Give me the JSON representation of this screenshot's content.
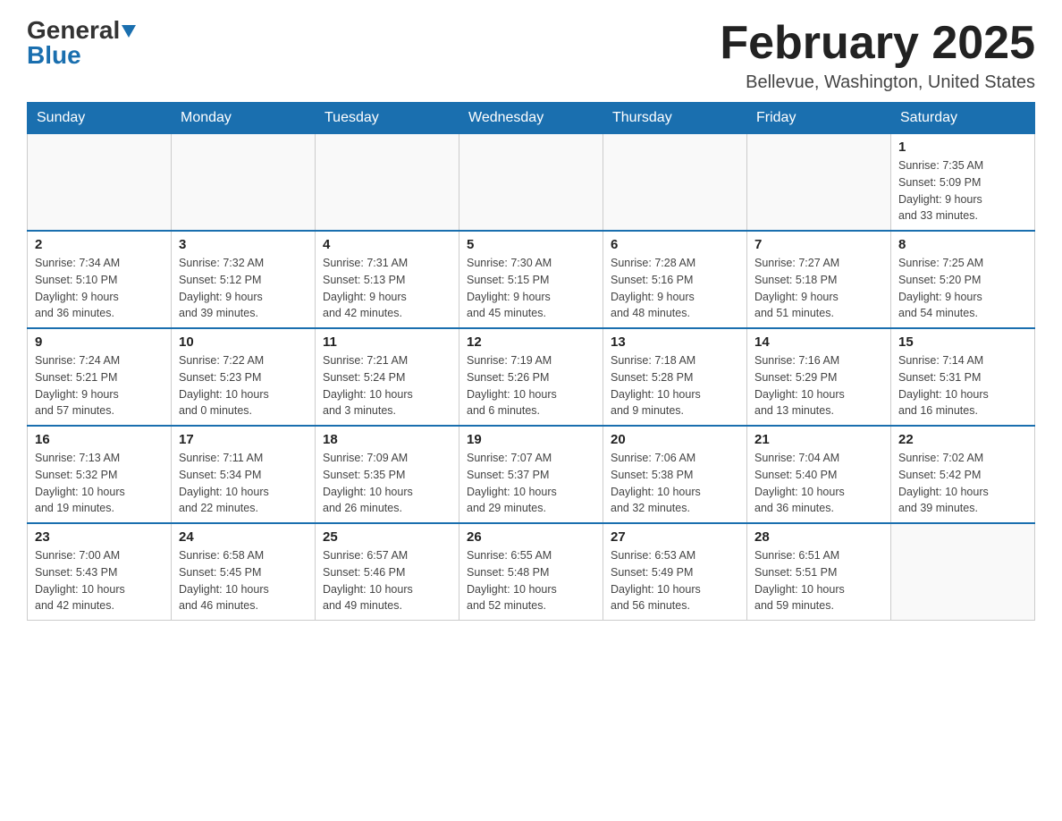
{
  "header": {
    "logo_general": "General",
    "logo_blue": "Blue",
    "month_title": "February 2025",
    "location": "Bellevue, Washington, United States"
  },
  "days_of_week": [
    "Sunday",
    "Monday",
    "Tuesday",
    "Wednesday",
    "Thursday",
    "Friday",
    "Saturday"
  ],
  "weeks": [
    {
      "days": [
        {
          "number": "",
          "info": ""
        },
        {
          "number": "",
          "info": ""
        },
        {
          "number": "",
          "info": ""
        },
        {
          "number": "",
          "info": ""
        },
        {
          "number": "",
          "info": ""
        },
        {
          "number": "",
          "info": ""
        },
        {
          "number": "1",
          "info": "Sunrise: 7:35 AM\nSunset: 5:09 PM\nDaylight: 9 hours\nand 33 minutes."
        }
      ]
    },
    {
      "days": [
        {
          "number": "2",
          "info": "Sunrise: 7:34 AM\nSunset: 5:10 PM\nDaylight: 9 hours\nand 36 minutes."
        },
        {
          "number": "3",
          "info": "Sunrise: 7:32 AM\nSunset: 5:12 PM\nDaylight: 9 hours\nand 39 minutes."
        },
        {
          "number": "4",
          "info": "Sunrise: 7:31 AM\nSunset: 5:13 PM\nDaylight: 9 hours\nand 42 minutes."
        },
        {
          "number": "5",
          "info": "Sunrise: 7:30 AM\nSunset: 5:15 PM\nDaylight: 9 hours\nand 45 minutes."
        },
        {
          "number": "6",
          "info": "Sunrise: 7:28 AM\nSunset: 5:16 PM\nDaylight: 9 hours\nand 48 minutes."
        },
        {
          "number": "7",
          "info": "Sunrise: 7:27 AM\nSunset: 5:18 PM\nDaylight: 9 hours\nand 51 minutes."
        },
        {
          "number": "8",
          "info": "Sunrise: 7:25 AM\nSunset: 5:20 PM\nDaylight: 9 hours\nand 54 minutes."
        }
      ]
    },
    {
      "days": [
        {
          "number": "9",
          "info": "Sunrise: 7:24 AM\nSunset: 5:21 PM\nDaylight: 9 hours\nand 57 minutes."
        },
        {
          "number": "10",
          "info": "Sunrise: 7:22 AM\nSunset: 5:23 PM\nDaylight: 10 hours\nand 0 minutes."
        },
        {
          "number": "11",
          "info": "Sunrise: 7:21 AM\nSunset: 5:24 PM\nDaylight: 10 hours\nand 3 minutes."
        },
        {
          "number": "12",
          "info": "Sunrise: 7:19 AM\nSunset: 5:26 PM\nDaylight: 10 hours\nand 6 minutes."
        },
        {
          "number": "13",
          "info": "Sunrise: 7:18 AM\nSunset: 5:28 PM\nDaylight: 10 hours\nand 9 minutes."
        },
        {
          "number": "14",
          "info": "Sunrise: 7:16 AM\nSunset: 5:29 PM\nDaylight: 10 hours\nand 13 minutes."
        },
        {
          "number": "15",
          "info": "Sunrise: 7:14 AM\nSunset: 5:31 PM\nDaylight: 10 hours\nand 16 minutes."
        }
      ]
    },
    {
      "days": [
        {
          "number": "16",
          "info": "Sunrise: 7:13 AM\nSunset: 5:32 PM\nDaylight: 10 hours\nand 19 minutes."
        },
        {
          "number": "17",
          "info": "Sunrise: 7:11 AM\nSunset: 5:34 PM\nDaylight: 10 hours\nand 22 minutes."
        },
        {
          "number": "18",
          "info": "Sunrise: 7:09 AM\nSunset: 5:35 PM\nDaylight: 10 hours\nand 26 minutes."
        },
        {
          "number": "19",
          "info": "Sunrise: 7:07 AM\nSunset: 5:37 PM\nDaylight: 10 hours\nand 29 minutes."
        },
        {
          "number": "20",
          "info": "Sunrise: 7:06 AM\nSunset: 5:38 PM\nDaylight: 10 hours\nand 32 minutes."
        },
        {
          "number": "21",
          "info": "Sunrise: 7:04 AM\nSunset: 5:40 PM\nDaylight: 10 hours\nand 36 minutes."
        },
        {
          "number": "22",
          "info": "Sunrise: 7:02 AM\nSunset: 5:42 PM\nDaylight: 10 hours\nand 39 minutes."
        }
      ]
    },
    {
      "days": [
        {
          "number": "23",
          "info": "Sunrise: 7:00 AM\nSunset: 5:43 PM\nDaylight: 10 hours\nand 42 minutes."
        },
        {
          "number": "24",
          "info": "Sunrise: 6:58 AM\nSunset: 5:45 PM\nDaylight: 10 hours\nand 46 minutes."
        },
        {
          "number": "25",
          "info": "Sunrise: 6:57 AM\nSunset: 5:46 PM\nDaylight: 10 hours\nand 49 minutes."
        },
        {
          "number": "26",
          "info": "Sunrise: 6:55 AM\nSunset: 5:48 PM\nDaylight: 10 hours\nand 52 minutes."
        },
        {
          "number": "27",
          "info": "Sunrise: 6:53 AM\nSunset: 5:49 PM\nDaylight: 10 hours\nand 56 minutes."
        },
        {
          "number": "28",
          "info": "Sunrise: 6:51 AM\nSunset: 5:51 PM\nDaylight: 10 hours\nand 59 minutes."
        },
        {
          "number": "",
          "info": ""
        }
      ]
    }
  ]
}
